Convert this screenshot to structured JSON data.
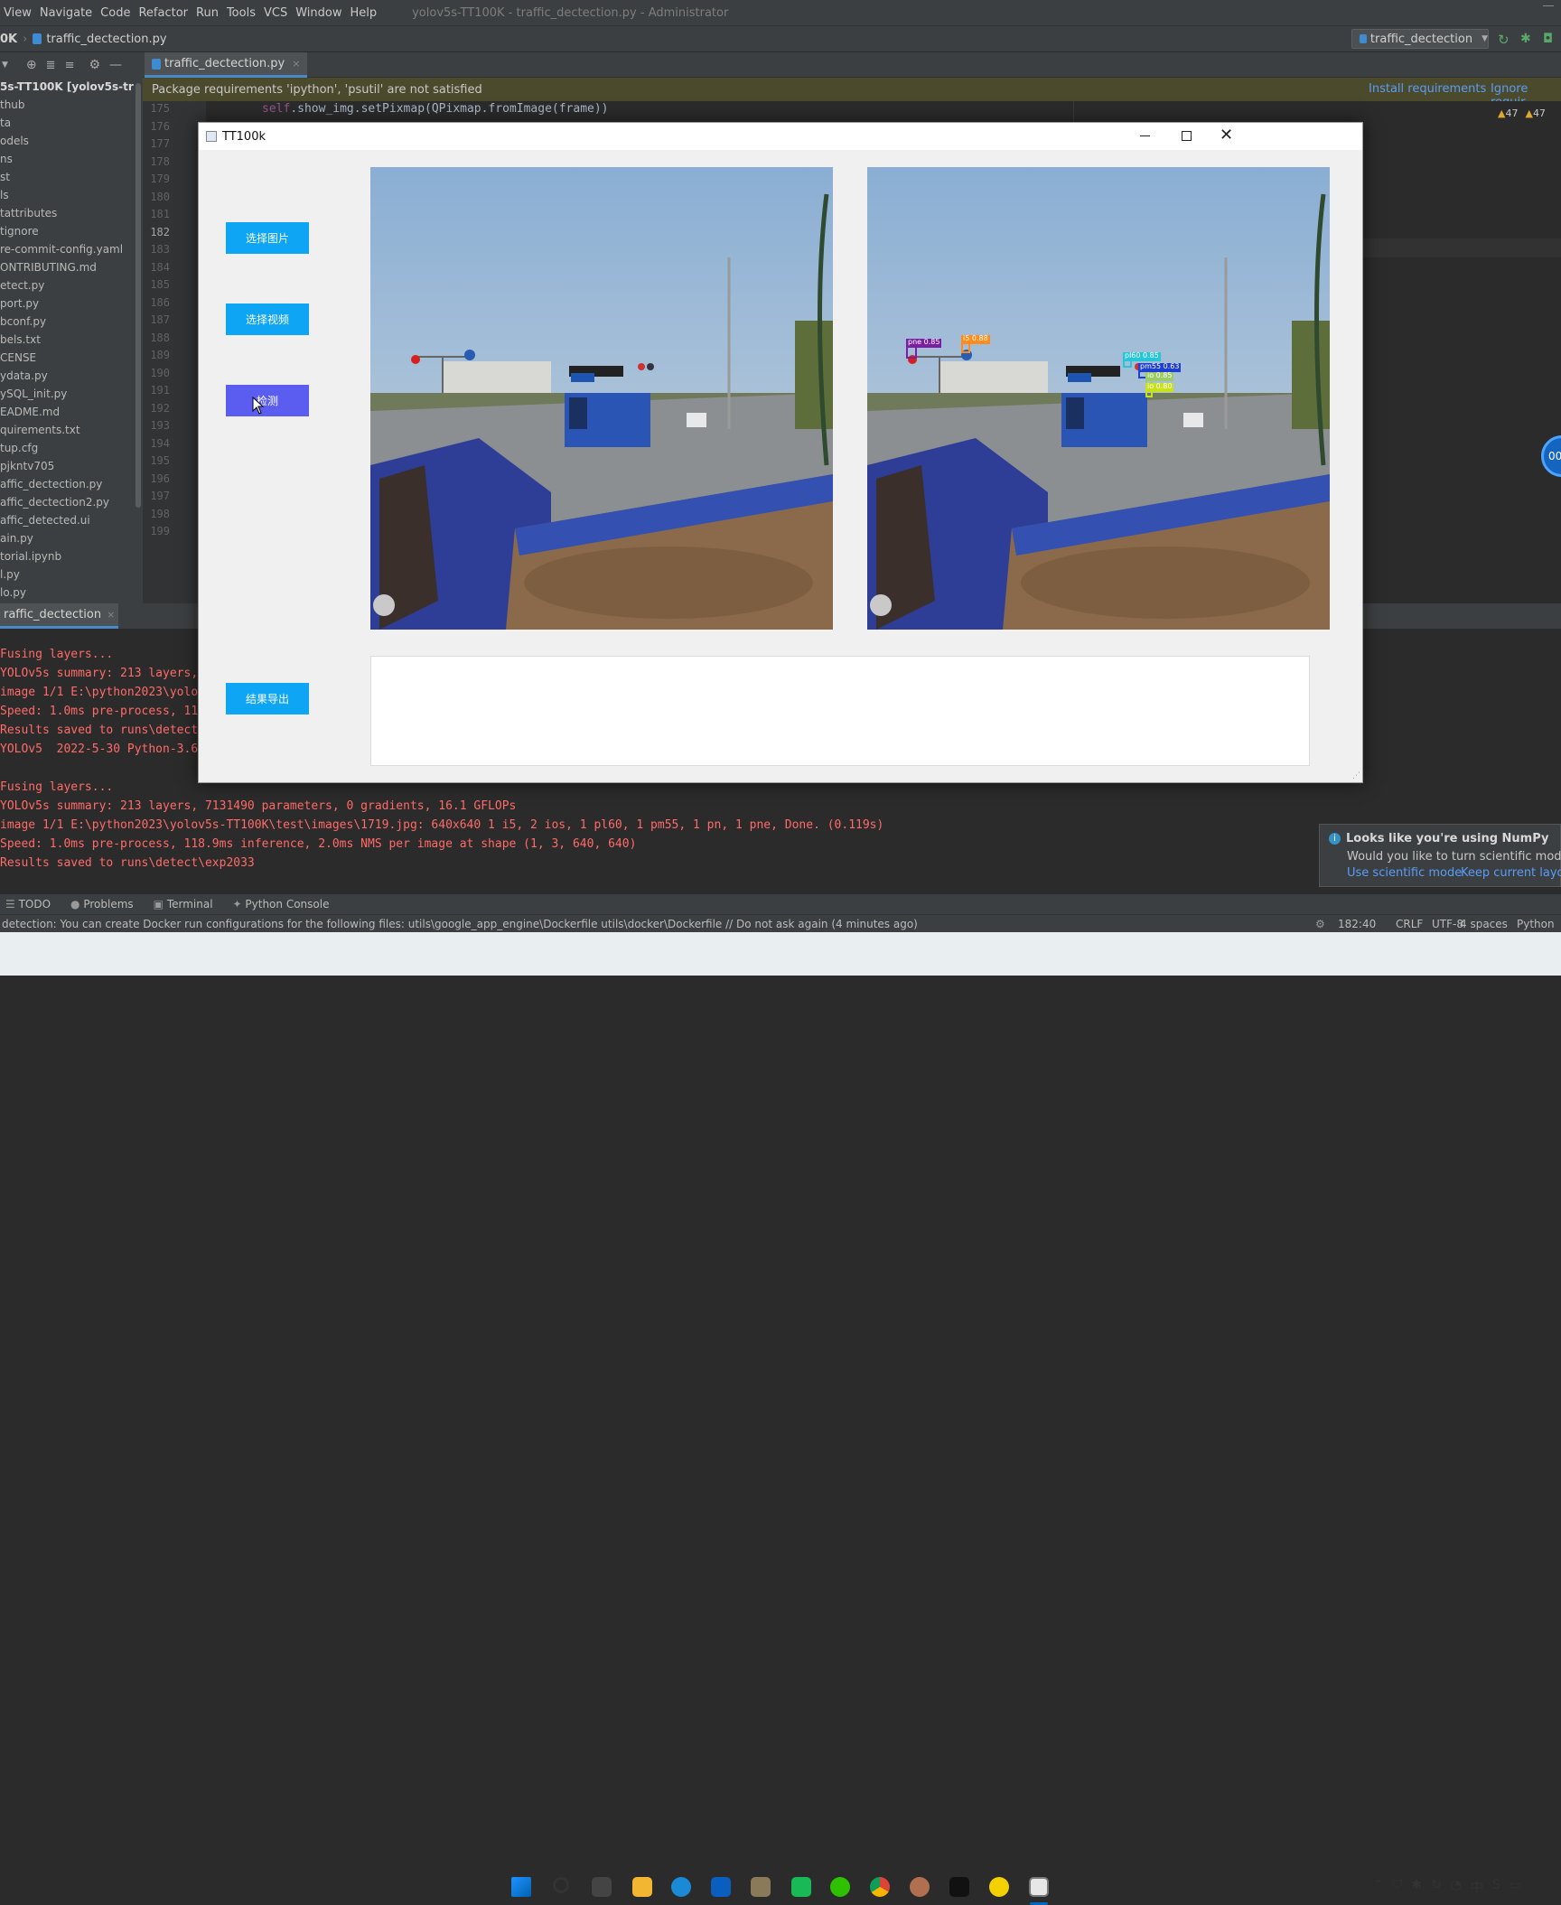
{
  "ide": {
    "menu": [
      "View",
      "Navigate",
      "Code",
      "Refactor",
      "Run",
      "Tools",
      "VCS",
      "Window",
      "Help"
    ],
    "window_title": "yolov5s-TT100K - traffic_dectection.py - Administrator",
    "breadcrumb": {
      "project": "0K",
      "file": "traffic_dectection.py"
    },
    "run_config": "traffic_dectection",
    "editor_tab": "traffic_dectection.py",
    "requirements_banner": {
      "message": "Package requirements 'ipython', 'psutil' are not satisfied",
      "install": "Install requirements",
      "ignore": "Ignore requir"
    },
    "warnings": {
      "a": "47",
      "b": "47"
    },
    "project_root": "5s-TT100K [yolov5s-transf",
    "project_items": [
      "thub",
      "ta",
      "odels",
      "ns",
      "st",
      "ls",
      "tattributes",
      "tignore",
      "re-commit-config.yaml",
      "ONTRIBUTING.md",
      "etect.py",
      "port.py",
      "bconf.py",
      "bels.txt",
      "CENSE",
      "ydata.py",
      "ySQL_init.py",
      "EADME.md",
      "quirements.txt",
      "tup.cfg",
      "pjkntv705",
      "affic_dectection.py",
      "affic_dectection2.py",
      "affic_detected.ui",
      "ain.py",
      "torial.ipynb",
      "l.py",
      "lo.py"
    ],
    "line_numbers": [
      "175",
      "176",
      "177",
      "178",
      "179",
      "180",
      "181",
      "182",
      "183",
      "184",
      "185",
      "186",
      "187",
      "188",
      "189",
      "190",
      "191",
      "192",
      "193",
      "194",
      "195",
      "196",
      "197",
      "198",
      "199"
    ],
    "current_line": "182",
    "code_line_175": {
      "self": "self",
      "rest": ".show_img.setPixmap(QPixmap.fromImage(frame))"
    },
    "run_tab": "raffic_dectection",
    "console": [
      "Fusing layers...",
      "YOLOv5s summary: 213 layers,",
      "image 1/1 E:\\python2023\\yolo",
      "Speed: 1.0ms pre-process, 11",
      "Results saved to runs\\detect",
      "YOLOv5  2022-5-30 Python-3.6",
      "",
      "Fusing layers...",
      "YOLOv5s summary: 213 layers, 7131490 parameters, 0 gradients, 16.1 GFLOPs",
      "image 1/1 E:\\python2023\\yolov5s-TT100K\\test\\images\\1719.jpg: 640x640 1 i5, 2 ios, 1 pl60, 1 pm55, 1 pn, 1 pne, Done. (0.119s)",
      "Speed: 1.0ms pre-process, 118.9ms inference, 2.0ms NMS per image at shape (1, 3, 640, 640)",
      "Results saved to runs\\detect\\exp2033"
    ],
    "bottom_tabs": [
      "TODO",
      "Problems",
      "Terminal",
      "Python Console"
    ],
    "status_message": "detection: You can create Docker run configurations for the following files: utils\\google_app_engine\\Dockerfile utils\\docker\\Dockerfile // Do not ask again (4 minutes ago)",
    "status_right": [
      "182:40",
      "CRLF",
      "UTF-8",
      "4 spaces",
      "Python 3"
    ],
    "notification": {
      "title": "Looks like you're using NumPy",
      "body": "Would you like to turn scientific mode on",
      "link1": "Use scientific mode",
      "link2": "Keep current layout"
    },
    "side_badge": "00"
  },
  "app": {
    "title": "TT100k",
    "buttons": {
      "select_image": "选择图片",
      "select_video": "选择视频",
      "detect": "检测",
      "export": "结果导出"
    },
    "detections": [
      {
        "label": "pne 0.85",
        "color": "#7b1fa2"
      },
      {
        "label": "i5 0.88",
        "color": "#ff8c1a"
      },
      {
        "label": "pl60 0.85",
        "color": "#26c6da"
      },
      {
        "label": "pm55 0.63",
        "color": "#1e3fd0"
      },
      {
        "label": "io 0.85",
        "color": "#9ccc65"
      },
      {
        "label": "io 0.80",
        "color": "#c6e21a"
      }
    ]
  },
  "colors": {
    "accent_button": "#0ea5f5",
    "active_button": "#5b5cf0",
    "console_text": "#ff6b68"
  }
}
